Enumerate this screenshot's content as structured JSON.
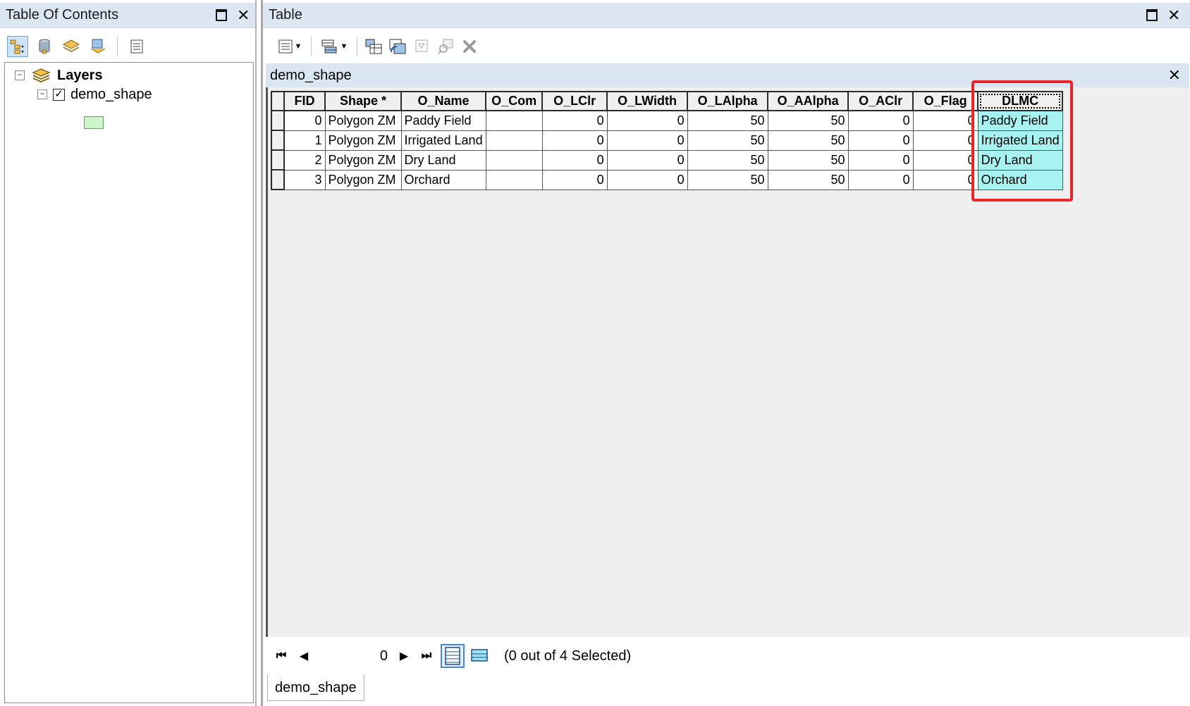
{
  "toc": {
    "title": "Table Of Contents",
    "root_label": "Layers",
    "layer_name": "demo_shape",
    "layer_checked": true
  },
  "table_window": {
    "title": "Table",
    "tab_label": "demo_shape",
    "bottom_tab": "demo_shape"
  },
  "table": {
    "columns": [
      "FID",
      "Shape *",
      "O_Name",
      "O_Com",
      "O_LClr",
      "O_LWidth",
      "O_LAlpha",
      "O_AAlpha",
      "O_AClr",
      "O_Flag",
      "DLMC"
    ],
    "rows": [
      [
        "0",
        "Polygon ZM",
        "Paddy Field",
        "",
        "0",
        "0",
        "50",
        "50",
        "0",
        "0",
        "Paddy Field"
      ],
      [
        "1",
        "Polygon ZM",
        "Irrigated Land",
        "",
        "0",
        "0",
        "50",
        "50",
        "0",
        "0",
        "Irrigated Land"
      ],
      [
        "2",
        "Polygon ZM",
        "Dry Land",
        "",
        "0",
        "0",
        "50",
        "50",
        "0",
        "0",
        "Dry Land"
      ],
      [
        "3",
        "Polygon ZM",
        "Orchard",
        "",
        "0",
        "0",
        "50",
        "50",
        "0",
        "0",
        "Orchard"
      ]
    ],
    "highlighted_column": "DLMC",
    "highlight_color": "#e8252b",
    "highlight_fill": "#a6f3f1"
  },
  "navigation": {
    "current_record": "0",
    "selection_status": "(0 out of 4 Selected)"
  }
}
